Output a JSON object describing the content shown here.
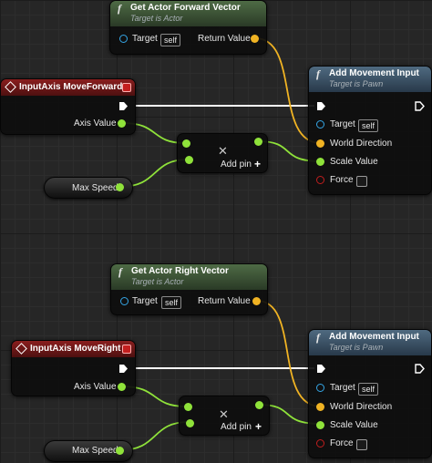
{
  "forward_section": {
    "get_vector_node": {
      "title": "Get Actor Forward Vector",
      "subtitle": "Target is Actor",
      "target_label": "Target",
      "target_value": "self",
      "return_label": "Return Value",
      "icon": "function-icon"
    },
    "input_event": {
      "title": "InputAxis MoveForward",
      "axis_label": "Axis Value"
    },
    "multiply_node": {
      "add_pin_label": "Add pin",
      "op_icon": "multiply-icon"
    },
    "max_speed_var": {
      "label": "Max Speed"
    },
    "movement_node": {
      "title": "Add Movement Input",
      "subtitle": "Target is Pawn",
      "target_label": "Target",
      "target_value": "self",
      "world_direction_label": "World Direction",
      "scale_value_label": "Scale Value",
      "force_label": "Force",
      "force_checked": false,
      "icon": "function-icon"
    }
  },
  "right_section": {
    "get_vector_node": {
      "title": "Get Actor Right Vector",
      "subtitle": "Target is Actor",
      "target_label": "Target",
      "target_value": "self",
      "return_label": "Return Value",
      "icon": "function-icon"
    },
    "input_event": {
      "title": "InputAxis MoveRight",
      "axis_label": "Axis Value"
    },
    "multiply_node": {
      "add_pin_label": "Add pin",
      "op_icon": "multiply-icon"
    },
    "max_speed_var": {
      "label": "Max Speed"
    },
    "movement_node": {
      "title": "Add Movement Input",
      "subtitle": "Target is Pawn",
      "target_label": "Target",
      "target_value": "self",
      "world_direction_label": "World Direction",
      "scale_value_label": "Scale Value",
      "force_label": "Force",
      "force_checked": false,
      "icon": "function-icon"
    }
  },
  "colors": {
    "exec_wire": "#ffffff",
    "float_pin": "#8fe23a",
    "vector_pin": "#f0b323",
    "object_pin": "#35a6e6",
    "bool_pin": "#c01e1e",
    "function_header": "#4f6a80",
    "pure_function_header": "#4e6b45",
    "event_header": "#8a1e1e",
    "canvas_background": "#262626"
  }
}
